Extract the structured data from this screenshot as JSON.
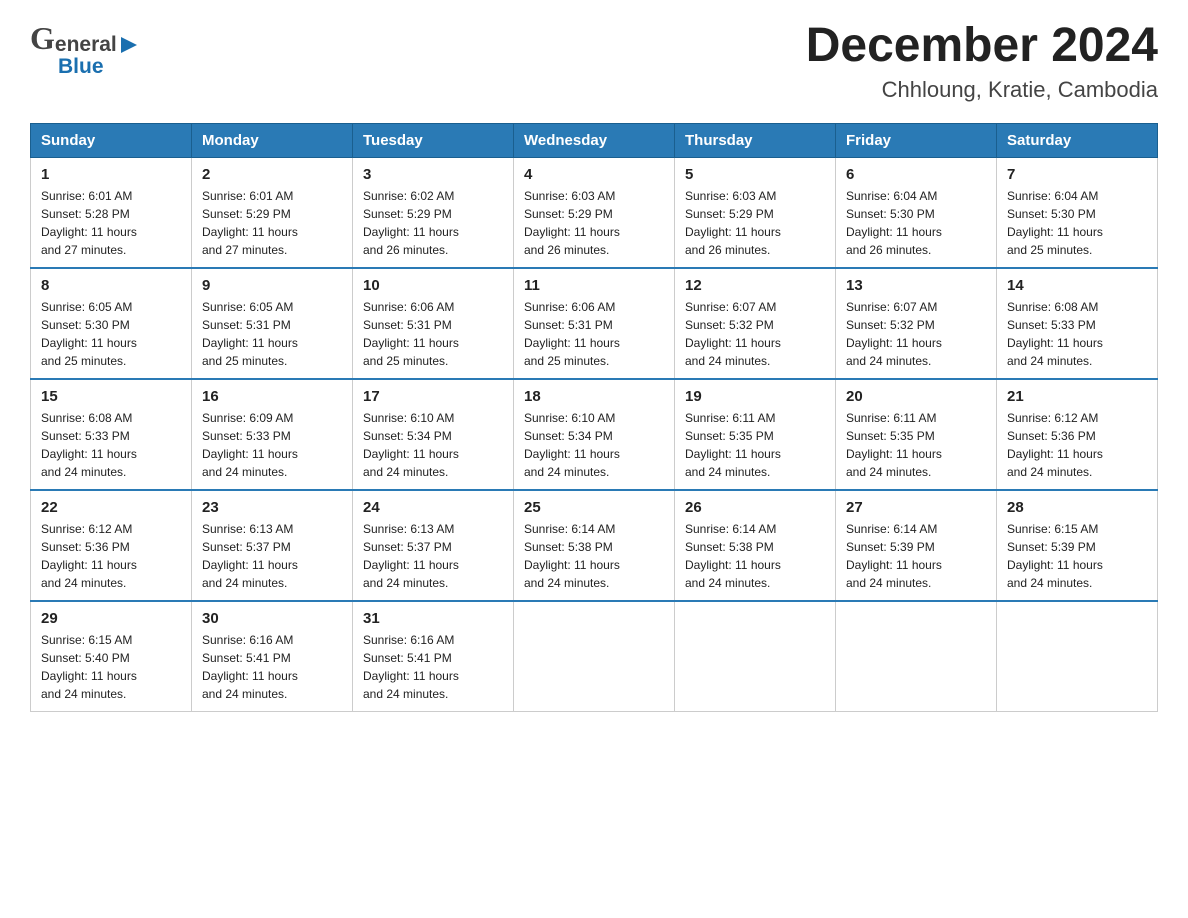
{
  "header": {
    "logo_text_1": "General",
    "logo_text_2": "Blue",
    "month_year": "December 2024",
    "location": "Chhloung, Kratie, Cambodia"
  },
  "days_of_week": [
    "Sunday",
    "Monday",
    "Tuesday",
    "Wednesday",
    "Thursday",
    "Friday",
    "Saturday"
  ],
  "weeks": [
    [
      {
        "day": "1",
        "sunrise": "6:01 AM",
        "sunset": "5:28 PM",
        "daylight": "11 hours and 27 minutes."
      },
      {
        "day": "2",
        "sunrise": "6:01 AM",
        "sunset": "5:29 PM",
        "daylight": "11 hours and 27 minutes."
      },
      {
        "day": "3",
        "sunrise": "6:02 AM",
        "sunset": "5:29 PM",
        "daylight": "11 hours and 26 minutes."
      },
      {
        "day": "4",
        "sunrise": "6:03 AM",
        "sunset": "5:29 PM",
        "daylight": "11 hours and 26 minutes."
      },
      {
        "day": "5",
        "sunrise": "6:03 AM",
        "sunset": "5:29 PM",
        "daylight": "11 hours and 26 minutes."
      },
      {
        "day": "6",
        "sunrise": "6:04 AM",
        "sunset": "5:30 PM",
        "daylight": "11 hours and 26 minutes."
      },
      {
        "day": "7",
        "sunrise": "6:04 AM",
        "sunset": "5:30 PM",
        "daylight": "11 hours and 25 minutes."
      }
    ],
    [
      {
        "day": "8",
        "sunrise": "6:05 AM",
        "sunset": "5:30 PM",
        "daylight": "11 hours and 25 minutes."
      },
      {
        "day": "9",
        "sunrise": "6:05 AM",
        "sunset": "5:31 PM",
        "daylight": "11 hours and 25 minutes."
      },
      {
        "day": "10",
        "sunrise": "6:06 AM",
        "sunset": "5:31 PM",
        "daylight": "11 hours and 25 minutes."
      },
      {
        "day": "11",
        "sunrise": "6:06 AM",
        "sunset": "5:31 PM",
        "daylight": "11 hours and 25 minutes."
      },
      {
        "day": "12",
        "sunrise": "6:07 AM",
        "sunset": "5:32 PM",
        "daylight": "11 hours and 24 minutes."
      },
      {
        "day": "13",
        "sunrise": "6:07 AM",
        "sunset": "5:32 PM",
        "daylight": "11 hours and 24 minutes."
      },
      {
        "day": "14",
        "sunrise": "6:08 AM",
        "sunset": "5:33 PM",
        "daylight": "11 hours and 24 minutes."
      }
    ],
    [
      {
        "day": "15",
        "sunrise": "6:08 AM",
        "sunset": "5:33 PM",
        "daylight": "11 hours and 24 minutes."
      },
      {
        "day": "16",
        "sunrise": "6:09 AM",
        "sunset": "5:33 PM",
        "daylight": "11 hours and 24 minutes."
      },
      {
        "day": "17",
        "sunrise": "6:10 AM",
        "sunset": "5:34 PM",
        "daylight": "11 hours and 24 minutes."
      },
      {
        "day": "18",
        "sunrise": "6:10 AM",
        "sunset": "5:34 PM",
        "daylight": "11 hours and 24 minutes."
      },
      {
        "day": "19",
        "sunrise": "6:11 AM",
        "sunset": "5:35 PM",
        "daylight": "11 hours and 24 minutes."
      },
      {
        "day": "20",
        "sunrise": "6:11 AM",
        "sunset": "5:35 PM",
        "daylight": "11 hours and 24 minutes."
      },
      {
        "day": "21",
        "sunrise": "6:12 AM",
        "sunset": "5:36 PM",
        "daylight": "11 hours and 24 minutes."
      }
    ],
    [
      {
        "day": "22",
        "sunrise": "6:12 AM",
        "sunset": "5:36 PM",
        "daylight": "11 hours and 24 minutes."
      },
      {
        "day": "23",
        "sunrise": "6:13 AM",
        "sunset": "5:37 PM",
        "daylight": "11 hours and 24 minutes."
      },
      {
        "day": "24",
        "sunrise": "6:13 AM",
        "sunset": "5:37 PM",
        "daylight": "11 hours and 24 minutes."
      },
      {
        "day": "25",
        "sunrise": "6:14 AM",
        "sunset": "5:38 PM",
        "daylight": "11 hours and 24 minutes."
      },
      {
        "day": "26",
        "sunrise": "6:14 AM",
        "sunset": "5:38 PM",
        "daylight": "11 hours and 24 minutes."
      },
      {
        "day": "27",
        "sunrise": "6:14 AM",
        "sunset": "5:39 PM",
        "daylight": "11 hours and 24 minutes."
      },
      {
        "day": "28",
        "sunrise": "6:15 AM",
        "sunset": "5:39 PM",
        "daylight": "11 hours and 24 minutes."
      }
    ],
    [
      {
        "day": "29",
        "sunrise": "6:15 AM",
        "sunset": "5:40 PM",
        "daylight": "11 hours and 24 minutes."
      },
      {
        "day": "30",
        "sunrise": "6:16 AM",
        "sunset": "5:41 PM",
        "daylight": "11 hours and 24 minutes."
      },
      {
        "day": "31",
        "sunrise": "6:16 AM",
        "sunset": "5:41 PM",
        "daylight": "11 hours and 24 minutes."
      },
      null,
      null,
      null,
      null
    ]
  ],
  "labels": {
    "sunrise": "Sunrise:",
    "sunset": "Sunset:",
    "daylight": "Daylight:"
  }
}
